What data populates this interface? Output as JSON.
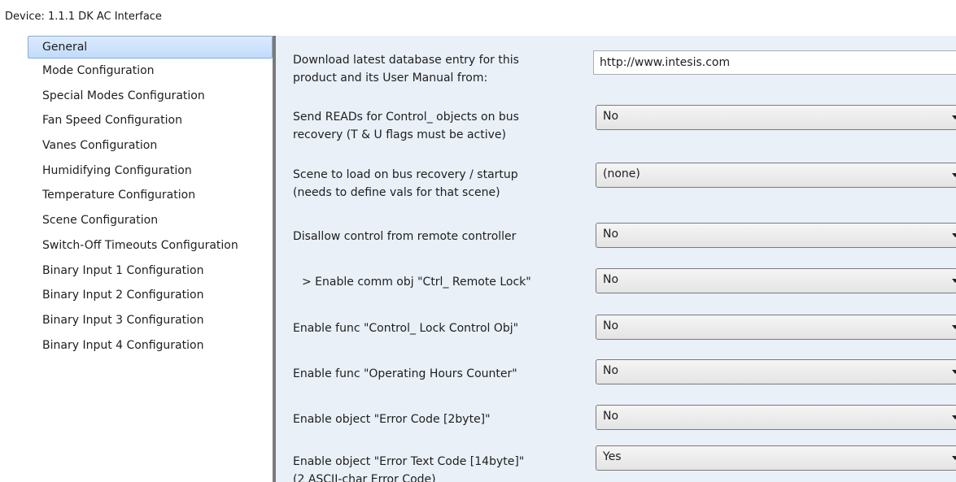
{
  "window": {
    "title": "Device: 1.1.1  DK AC Interface"
  },
  "sidebar": {
    "items": [
      {
        "label": "General",
        "selected": true
      },
      {
        "label": "Mode Configuration"
      },
      {
        "label": "Special Modes Configuration"
      },
      {
        "label": "Fan Speed Configuration"
      },
      {
        "label": "Vanes Configuration"
      },
      {
        "label": "Humidifying Configuration"
      },
      {
        "label": "Temperature Configuration"
      },
      {
        "label": "Scene Configuration"
      },
      {
        "label": "Switch-Off Timeouts Configuration"
      },
      {
        "label": "Binary Input 1 Configuration"
      },
      {
        "label": "Binary Input 2 Configuration"
      },
      {
        "label": "Binary Input 3 Configuration"
      },
      {
        "label": "Binary Input 4 Configuration"
      }
    ]
  },
  "params": {
    "download": {
      "label_line1": "Download latest database entry for this",
      "label_line2": "product and its User Manual from:",
      "value": "http://www.intesis.com"
    },
    "send_reads": {
      "label_line1": "Send READs for Control_ objects on bus",
      "label_line2": "recovery (T & U flags must be active)",
      "value": "No"
    },
    "scene_load": {
      "label_line1": "Scene to load on bus recovery / startup",
      "label_line2": "(needs to define vals for that scene)",
      "value": "(none)"
    },
    "disallow_remote": {
      "label": "Disallow control from remote controller",
      "value": "No"
    },
    "remote_lock": {
      "label": "> Enable comm obj \"Ctrl_ Remote Lock\"",
      "value": "No"
    },
    "lock_control": {
      "label": "Enable func \"Control_ Lock Control Obj\"",
      "value": "No"
    },
    "hours_counter": {
      "label": "Enable func \"Operating Hours Counter\"",
      "value": "No"
    },
    "error_code": {
      "label": "Enable object \"Error Code [2byte]\"",
      "value": "No"
    },
    "error_text": {
      "label_line1": "Enable object \"Error Text Code [14byte]\"",
      "label_line2": "(2 ASCII-char Error Code)",
      "value": "Yes"
    }
  },
  "colors": {
    "panel_bg": "#e9f0f8",
    "selection": "#c1dbfa",
    "splitter": "#7a7a7a"
  }
}
